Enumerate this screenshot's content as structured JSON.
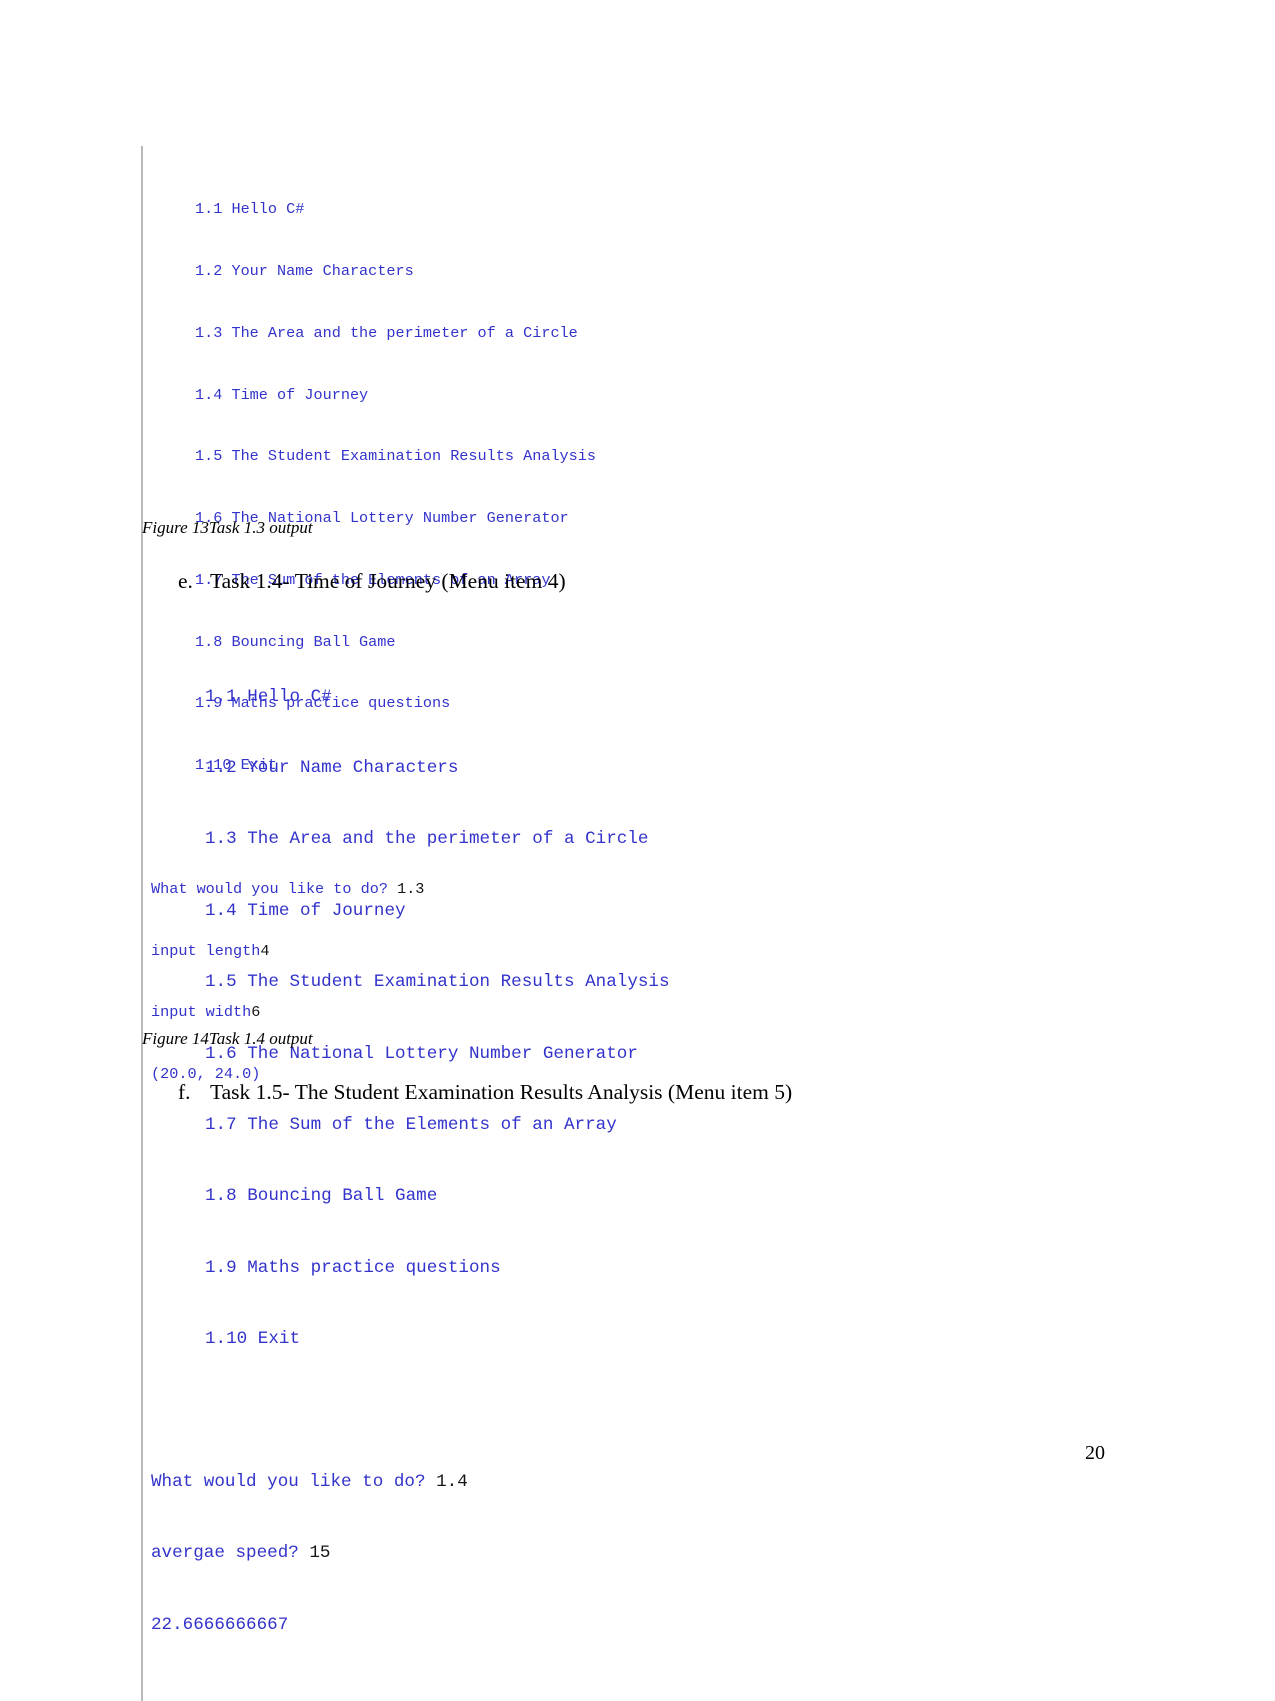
{
  "document": {
    "page_number": "20"
  },
  "figure_13": {
    "caption": "Figure 13Task 1.3 output",
    "menu": [
      "1.1 Hello C#",
      "1.2 Your Name Characters",
      "1.3 The Area and the perimeter of a Circle",
      "1.4 Time of Journey",
      "1.5 The Student Examination Results Analysis",
      "1.6 The National Lottery Number Generator",
      "1.7 The Sum of the Elements of an Array",
      "1.8 Bouncing Ball Game",
      "1.9 Maths practice questions",
      "1.10 Exit"
    ],
    "prompt_1_label": "What would you like to do? ",
    "prompt_1_value": "1.3",
    "prompt_2_label": "input length",
    "prompt_2_value": "4",
    "prompt_3_label": "input width",
    "prompt_3_value": "6",
    "result": "(20.0, 24.0)"
  },
  "figure_14": {
    "caption": "Figure 14Task 1.4 output",
    "menu": [
      "1.1 Hello C#",
      "1.2 Your Name Characters",
      "1.3 The Area and the perimeter of a Circle",
      "1.4 Time of Journey",
      "1.5 The Student Examination Results Analysis",
      "1.6 The National Lottery Number Generator",
      "1.7 The Sum of the Elements of an Array",
      "1.8 Bouncing Ball Game",
      "1.9 Maths practice questions",
      "1.10 Exit"
    ],
    "prompt_1_label": "What would you like to do? ",
    "prompt_1_value": "1.4",
    "prompt_2_label": "avergae speed? ",
    "prompt_2_value": "15",
    "result": "22.6666666667"
  },
  "list_items": [
    {
      "marker": "e.",
      "text": "Task 1.4- Time of Journey (Menu item 4)"
    },
    {
      "marker": "f.",
      "text": "Task 1.5- The Student Examination Results Analysis (Menu item 5)"
    }
  ],
  "colors": {
    "console_text": "#3333cc",
    "user_input": "#151515",
    "block_rule": "#b9b9b9"
  }
}
